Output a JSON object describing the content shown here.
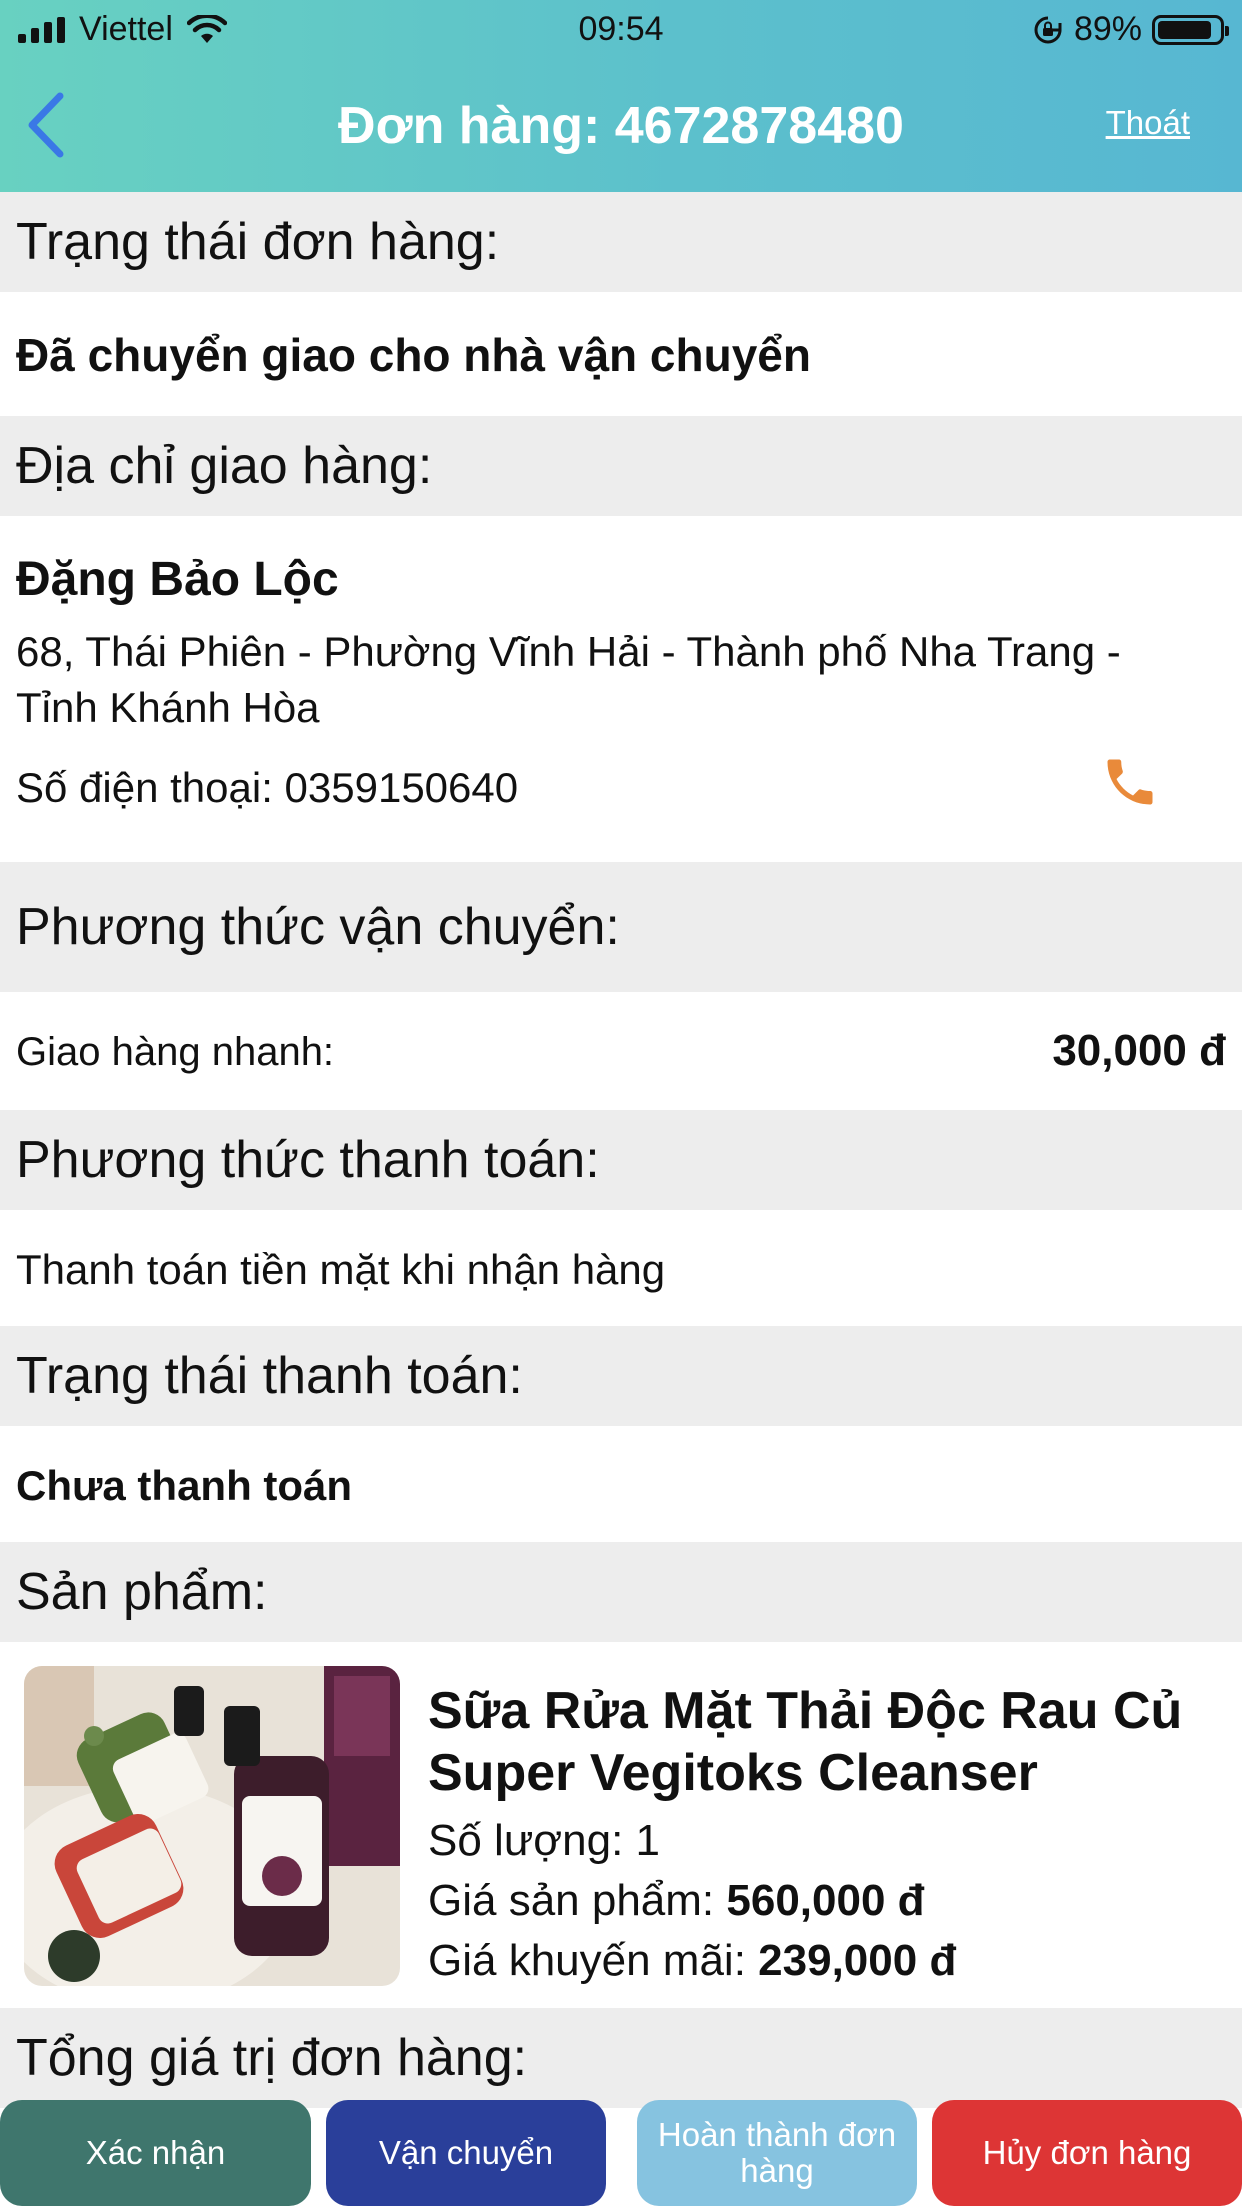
{
  "status_bar": {
    "carrier": "Viettel",
    "time": "09:54",
    "battery": "89%"
  },
  "nav": {
    "title": "Đơn hàng: 4672878480",
    "exit_label": "Thoát"
  },
  "order_status": {
    "heading": "Trạng thái đơn hàng:",
    "value": "Đã chuyển giao cho nhà vận chuyển"
  },
  "address": {
    "heading": "Địa chỉ giao hàng:",
    "name": "Đặng Bảo Lộc",
    "line1": "68, Thái Phiên - Phường Vĩnh Hải - Thành phố Nha Trang -",
    "line2": "Tỉnh Khánh Hòa",
    "phone": "Số điện thoại: 0359150640"
  },
  "shipping": {
    "heading": "Phương thức vận chuyển:",
    "method": "Giao hàng nhanh:",
    "fee": "30,000 đ"
  },
  "payment": {
    "heading": "Phương thức thanh toán:",
    "method": "Thanh toán tiền mặt khi nhận hàng"
  },
  "payment_status": {
    "heading": "Trạng thái thanh toán:",
    "value": "Chưa thanh toán"
  },
  "products": {
    "heading": "Sản phẩm:",
    "items": [
      {
        "name": "Sữa Rửa Mặt Thải Độc Rau Củ Super Vegitoks Cleanser",
        "qty_label": "Số lượng: 1",
        "price_label": "Giá sản phẩm:",
        "price": "560,000 đ",
        "sale_label": "Giá khuyến mãi:",
        "sale_price": "239,000 đ"
      }
    ]
  },
  "total": {
    "heading": "Tổng giá trị đơn hàng:"
  },
  "actions": {
    "confirm": "Xác nhận",
    "ship": "Vận chuyển",
    "complete": "Hoàn thành đơn hàng",
    "cancel": "Hủy đơn hàng"
  },
  "colors": {
    "header_start": "#68d1c1",
    "header_end": "#57b7d2",
    "section_bg": "#ededed",
    "back_arrow": "#3a78e6",
    "phone_icon": "#e98a3a",
    "btn_confirm": "#3f766d",
    "btn_ship": "#2a3f9a",
    "btn_complete": "#86c3e0",
    "btn_cancel": "#dd3535"
  }
}
